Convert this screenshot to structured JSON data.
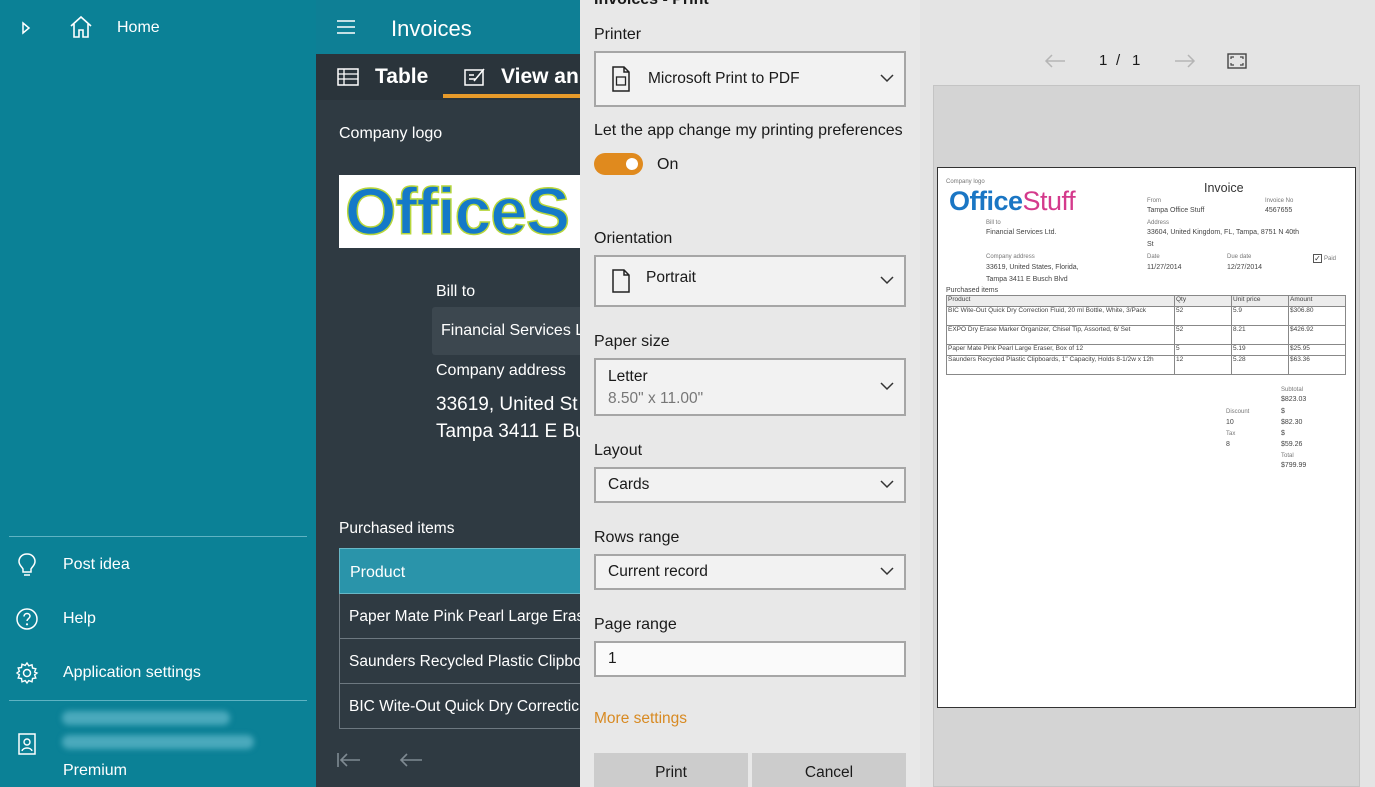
{
  "nav": {
    "home_label": "Home",
    "post_idea_label": "Post idea",
    "help_label": "Help",
    "settings_label": "Application settings",
    "account": {
      "name_blurred": "",
      "email_blurred": "",
      "plan_label": "Premium"
    }
  },
  "app": {
    "title": "Invoices",
    "tabs": [
      {
        "label": "Table"
      },
      {
        "label": "View an"
      }
    ],
    "company_logo_label": "Company logo",
    "logo_text": "OfficeS",
    "bill_to_label": "Bill to",
    "bill_to_value": "Financial Services Lt",
    "company_address_label": "Company address",
    "company_address_lines": [
      "33619, United St",
      "Tampa 3411 E Bu"
    ],
    "purchased_items_label": "Purchased items",
    "items_table": {
      "header": "Product",
      "rows": [
        "Paper Mate Pink Pearl Large Erase",
        "Saunders Recycled Plastic Clipboa",
        "BIC Wite-Out Quick Dry Correctic"
      ]
    }
  },
  "dialog": {
    "title": "Invoices - Print",
    "printer_label": "Printer",
    "printer_value": "Microsoft Print to PDF",
    "prefs_label": "Let the app change my printing preferences",
    "prefs_toggle_text": "On",
    "prefs_toggle_on": true,
    "orientation_label": "Orientation",
    "orientation_value": "Portrait",
    "paper_size_label": "Paper size",
    "paper_size_value": "Letter",
    "paper_size_sub": "8.50\" x 11.00\"",
    "layout_label": "Layout",
    "layout_value": "Cards",
    "rows_range_label": "Rows range",
    "rows_range_value": "Current record",
    "page_range_label": "Page range",
    "page_range_value": "1",
    "more_settings_label": "More settings",
    "print_button": "Print",
    "cancel_button": "Cancel",
    "accent_color": "#e08a1e"
  },
  "preview": {
    "page_current": "1",
    "page_separator": "/",
    "page_total": "1",
    "doc": {
      "company_logo_label": "Company logo",
      "logo_office": "Office",
      "logo_stuff": "Stuff",
      "title": "Invoice",
      "from_label": "From",
      "from_value": "Tampa Office Stuff",
      "invoice_no_label": "Invoice No",
      "invoice_no_value": "4567655",
      "bill_to_label": "Bill to",
      "bill_to_value": "Financial Services Ltd.",
      "address_label": "Address",
      "address_value_1": "33604, United Kingdom, FL, Tampa, 8751 N 40th",
      "address_value_2": "St",
      "company_address_label": "Company address",
      "company_address_1": "33619, United States, Florida,",
      "company_address_2": "Tampa 3411 E Busch Blvd",
      "date_label": "Date",
      "date_value": "11/27/2014",
      "due_date_label": "Due date",
      "due_date_value": "12/27/2014",
      "paid_label": "Paid",
      "purchased_items_label": "Purchased items",
      "table_headers": [
        "Product",
        "Qty",
        "Unit price",
        "Amount"
      ],
      "table_rows": [
        [
          "BIC Wite-Out Quick Dry Correction Fluid, 20 ml Bottle, White, 3/Pack",
          "52",
          "5.9",
          "$306.80"
        ],
        [
          "EXPO Dry Erase Marker Organizer, Chisel Tip, Assorted, 6/ Set",
          "52",
          "8.21",
          "$426.92"
        ],
        [
          "Paper Mate Pink Pearl Large Eraser, Box of 12",
          "5",
          "5.19",
          "$25.95"
        ],
        [
          "Saunders Recycled Plastic Clipboards, 1\" Capacity, Holds 8-1/2w x 12h",
          "12",
          "5.28",
          "$63.36"
        ]
      ],
      "subtotal_label": "Subtotal",
      "subtotal_value": "$823.03",
      "discount_label": "Discount",
      "discount_pct": "10",
      "discount_currency": "$",
      "discount_value": "$82.30",
      "tax_label": "Tax",
      "tax_pct": "8",
      "tax_currency": "$",
      "tax_value": "$59.26",
      "total_label": "Total",
      "total_value": "$799.99"
    }
  }
}
